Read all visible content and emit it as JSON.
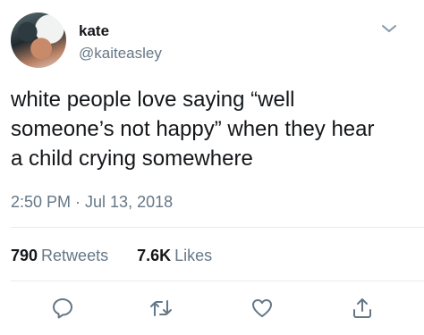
{
  "author": {
    "display_name": "kate",
    "handle": "@kaiteasley"
  },
  "tweet": {
    "text_lines": [
      "white people love saying “well",
      "someone’s not happy” when they hear",
      "a child crying somewhere"
    ],
    "timestamp": "2:50 PM · Jul 13, 2018"
  },
  "stats": {
    "retweets_count": "790",
    "retweets_label": "Retweets",
    "likes_count": "7.6K",
    "likes_label": "Likes"
  },
  "icons": {
    "menu": "chevron-down-icon",
    "reply": "reply-icon",
    "retweet": "retweet-icon",
    "like": "heart-icon",
    "share": "share-icon"
  },
  "colors": {
    "text": "#14171a",
    "secondary": "#657786",
    "divider": "#e6ecf0"
  }
}
